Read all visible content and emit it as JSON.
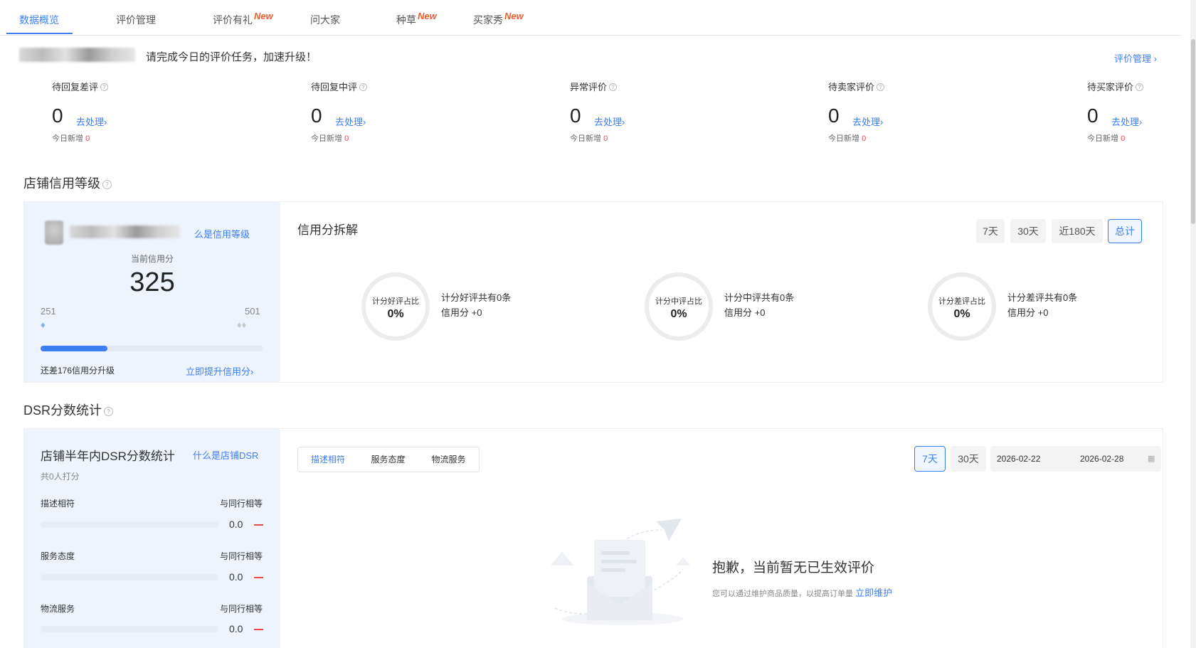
{
  "tabs": [
    {
      "label": "数据概览",
      "new": ""
    },
    {
      "label": "评价管理",
      "new": ""
    },
    {
      "label": "评价有礼",
      "new": "New"
    },
    {
      "label": "问大家",
      "new": ""
    },
    {
      "label": "种草",
      "new": "New"
    },
    {
      "label": "买家秀",
      "new": "New"
    }
  ],
  "notice": {
    "text": "请完成今日的评价任务，加速升级！",
    "link": "评价管理 ›"
  },
  "stats": [
    {
      "label": "待回复差评",
      "value": "0",
      "action": "去处理›",
      "today_label": "今日新增",
      "today_value": "0"
    },
    {
      "label": "待回复中评",
      "value": "0",
      "action": "去处理›",
      "today_label": "今日新增",
      "today_value": "0"
    },
    {
      "label": "异常评价",
      "value": "0",
      "action": "去处理›",
      "today_label": "今日新增",
      "today_value": "0"
    },
    {
      "label": "待卖家评价",
      "value": "0",
      "action": "去处理›",
      "today_label": "今日新增",
      "today_value": "0"
    },
    {
      "label": "待买家评价",
      "value": "0",
      "action": "去处理›",
      "today_label": "今日新增",
      "today_value": "0"
    }
  ],
  "credit": {
    "section_title": "店铺信用等级",
    "what_link": "么是信用等级",
    "current_label": "当前信用分",
    "score": "325",
    "range_min": "251",
    "range_max": "501",
    "progress": 0.3,
    "gap_text": "还差176信用分升级",
    "upgrade_link": "立即提升信用分›",
    "breakdown_title": "信用分拆解",
    "periods": [
      "7天",
      "30天",
      "近180天",
      "总计"
    ],
    "active_period": 3,
    "rings": [
      {
        "title": "计分好评占比",
        "value": "0%",
        "line1": "计分好评共有0条",
        "line2": "信用分 +0"
      },
      {
        "title": "计分中评占比",
        "value": "0%",
        "line1": "计分中评共有0条",
        "line2": "信用分 +0"
      },
      {
        "title": "计分差评占比",
        "value": "0%",
        "line1": "计分差评共有0条",
        "line2": "信用分 +0"
      }
    ]
  },
  "dsr": {
    "section_title": "DSR分数统计",
    "panel_title": "店铺半年内DSR分数统计",
    "what_link": "什么是店铺DSR",
    "raters": "共0人打分",
    "rows": [
      {
        "label": "描述相符",
        "compare": "与同行相等",
        "value": "0.0"
      },
      {
        "label": "服务态度",
        "compare": "与同行相等",
        "value": "0.0"
      },
      {
        "label": "物流服务",
        "compare": "与同行相等",
        "value": "0.0"
      }
    ],
    "segments": [
      "描述相符",
      "服务态度",
      "物流服务"
    ],
    "active_segment": 0,
    "periods": [
      "7天",
      "30天"
    ],
    "active_period": 0,
    "date_start": "2026-02-22",
    "date_end": "2026-02-28",
    "empty_title": "抱歉，当前暂无已生效评价",
    "empty_desc": "您可以通过维护商品质量，以提高订单量",
    "empty_link": "立即维护"
  },
  "colors": {
    "accent": "#3d7ef5",
    "danger": "#f0454b",
    "new": "#f05a2a"
  }
}
